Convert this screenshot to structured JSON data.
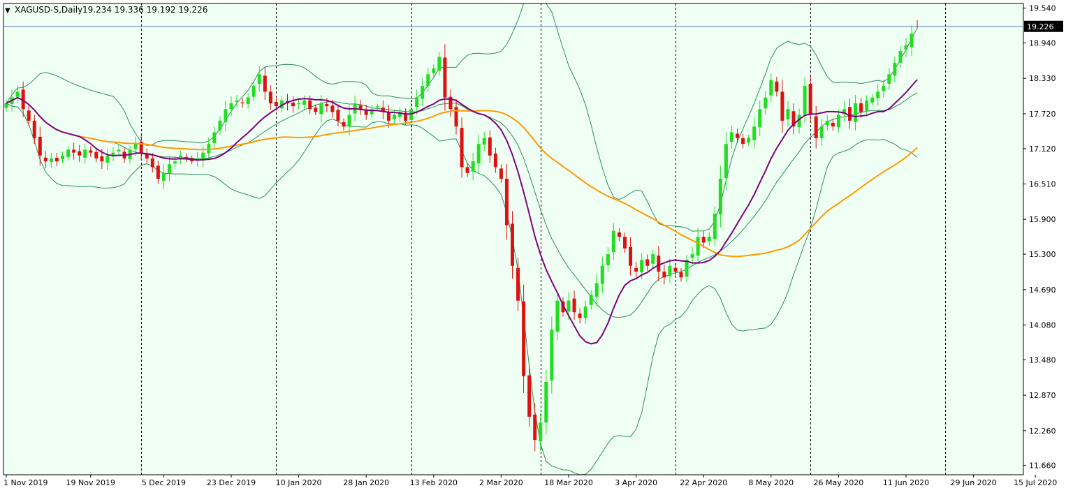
{
  "header": {
    "arrow": "▼",
    "symbol": "XAGUSD-S,Daily",
    "ohlc": "19.234 19.336 19.192 19.226"
  },
  "colors": {
    "background": "#F0FFF4",
    "bull": "#22DD22",
    "bear": "#DD1111",
    "ma_fast": "#800080",
    "ma_slow": "#FF9900",
    "bands": "#2E8B57",
    "price_line": "#5B7FA8",
    "price_tag_bg": "#000000",
    "price_tag_text": "#FFFFFF"
  },
  "chart_data": {
    "type": "candlestick",
    "current_price": 19.226,
    "current_price_label": "19.226",
    "ylim": [
      11.5,
      19.62
    ],
    "y_ticks": [
      "19.540",
      "18.940",
      "18.330",
      "17.720",
      "17.120",
      "16.510",
      "15.900",
      "15.300",
      "14.690",
      "14.080",
      "13.480",
      "12.870",
      "12.260",
      "11.660"
    ],
    "x_labels": [
      {
        "label": "1 Nov 2019",
        "index": 0
      },
      {
        "label": "19 Nov 2019",
        "index": 15
      },
      {
        "label": "5 Dec 2019",
        "index": 28
      },
      {
        "label": "23 Dec 2019",
        "index": 40
      },
      {
        "label": "10 Jan 2020",
        "index": 52
      },
      {
        "label": "28 Jan 2020",
        "index": 64
      },
      {
        "label": "13 Feb 2020",
        "index": 76
      },
      {
        "label": "2 Mar 2020",
        "index": 88
      },
      {
        "label": "18 Mar 2020",
        "index": 100
      },
      {
        "label": "3 Apr 2020",
        "index": 112
      },
      {
        "label": "22 Apr 2020",
        "index": 124
      },
      {
        "label": "8 May 2020",
        "index": 136
      },
      {
        "label": "26 May 2020",
        "index": 148
      },
      {
        "label": "11 Jun 2020",
        "index": 160
      },
      {
        "label": "29 Jun 2020",
        "index": 172
      },
      {
        "label": "15 Jul 2020",
        "index": 183
      }
    ],
    "separators": [
      24,
      48,
      72,
      95,
      119,
      143,
      167,
      191
    ],
    "closes": [
      17.9,
      18.0,
      18.1,
      17.8,
      17.6,
      17.3,
      17.0,
      16.9,
      16.95,
      16.9,
      17.0,
      17.1,
      17.05,
      17.0,
      17.1,
      17.05,
      16.95,
      16.9,
      17.0,
      17.05,
      17.1,
      16.95,
      17.1,
      17.2,
      17.05,
      16.95,
      16.8,
      16.6,
      16.7,
      16.85,
      16.9,
      17.0,
      16.95,
      16.9,
      16.95,
      17.05,
      17.2,
      17.4,
      17.6,
      17.8,
      17.9,
      17.95,
      17.9,
      18.0,
      18.2,
      18.4,
      18.1,
      17.9,
      17.85,
      17.95,
      17.9,
      17.85,
      17.9,
      17.95,
      17.8,
      17.75,
      17.9,
      17.85,
      17.75,
      17.6,
      17.5,
      17.7,
      17.9,
      17.8,
      17.7,
      17.8,
      17.85,
      17.75,
      17.6,
      17.7,
      17.75,
      17.6,
      17.8,
      18.0,
      18.2,
      18.4,
      18.5,
      18.7,
      18.0,
      17.8,
      17.5,
      16.8,
      16.7,
      16.9,
      17.2,
      17.3,
      17.0,
      16.8,
      16.6,
      15.8,
      15.1,
      14.5,
      13.2,
      12.5,
      12.1,
      12.4,
      13.1,
      14.0,
      14.5,
      14.3,
      14.5,
      14.3,
      14.2,
      14.4,
      14.6,
      14.8,
      15.1,
      15.3,
      15.7,
      15.6,
      15.4,
      15.1,
      15.0,
      15.2,
      15.1,
      15.3,
      15.0,
      14.9,
      15.1,
      15.0,
      14.9,
      15.2,
      15.3,
      15.6,
      15.5,
      15.6,
      16.0,
      16.6,
      17.2,
      17.4,
      17.3,
      17.2,
      17.3,
      17.5,
      17.8,
      18.0,
      18.3,
      18.1,
      17.6,
      17.8,
      17.5,
      17.7,
      18.2,
      17.7,
      17.3,
      17.5,
      17.6,
      17.5,
      17.7,
      17.8,
      17.6,
      17.9,
      17.75,
      17.95,
      18.0,
      18.1,
      18.2,
      18.4,
      18.6,
      18.8,
      18.9,
      19.1,
      19.226
    ]
  }
}
